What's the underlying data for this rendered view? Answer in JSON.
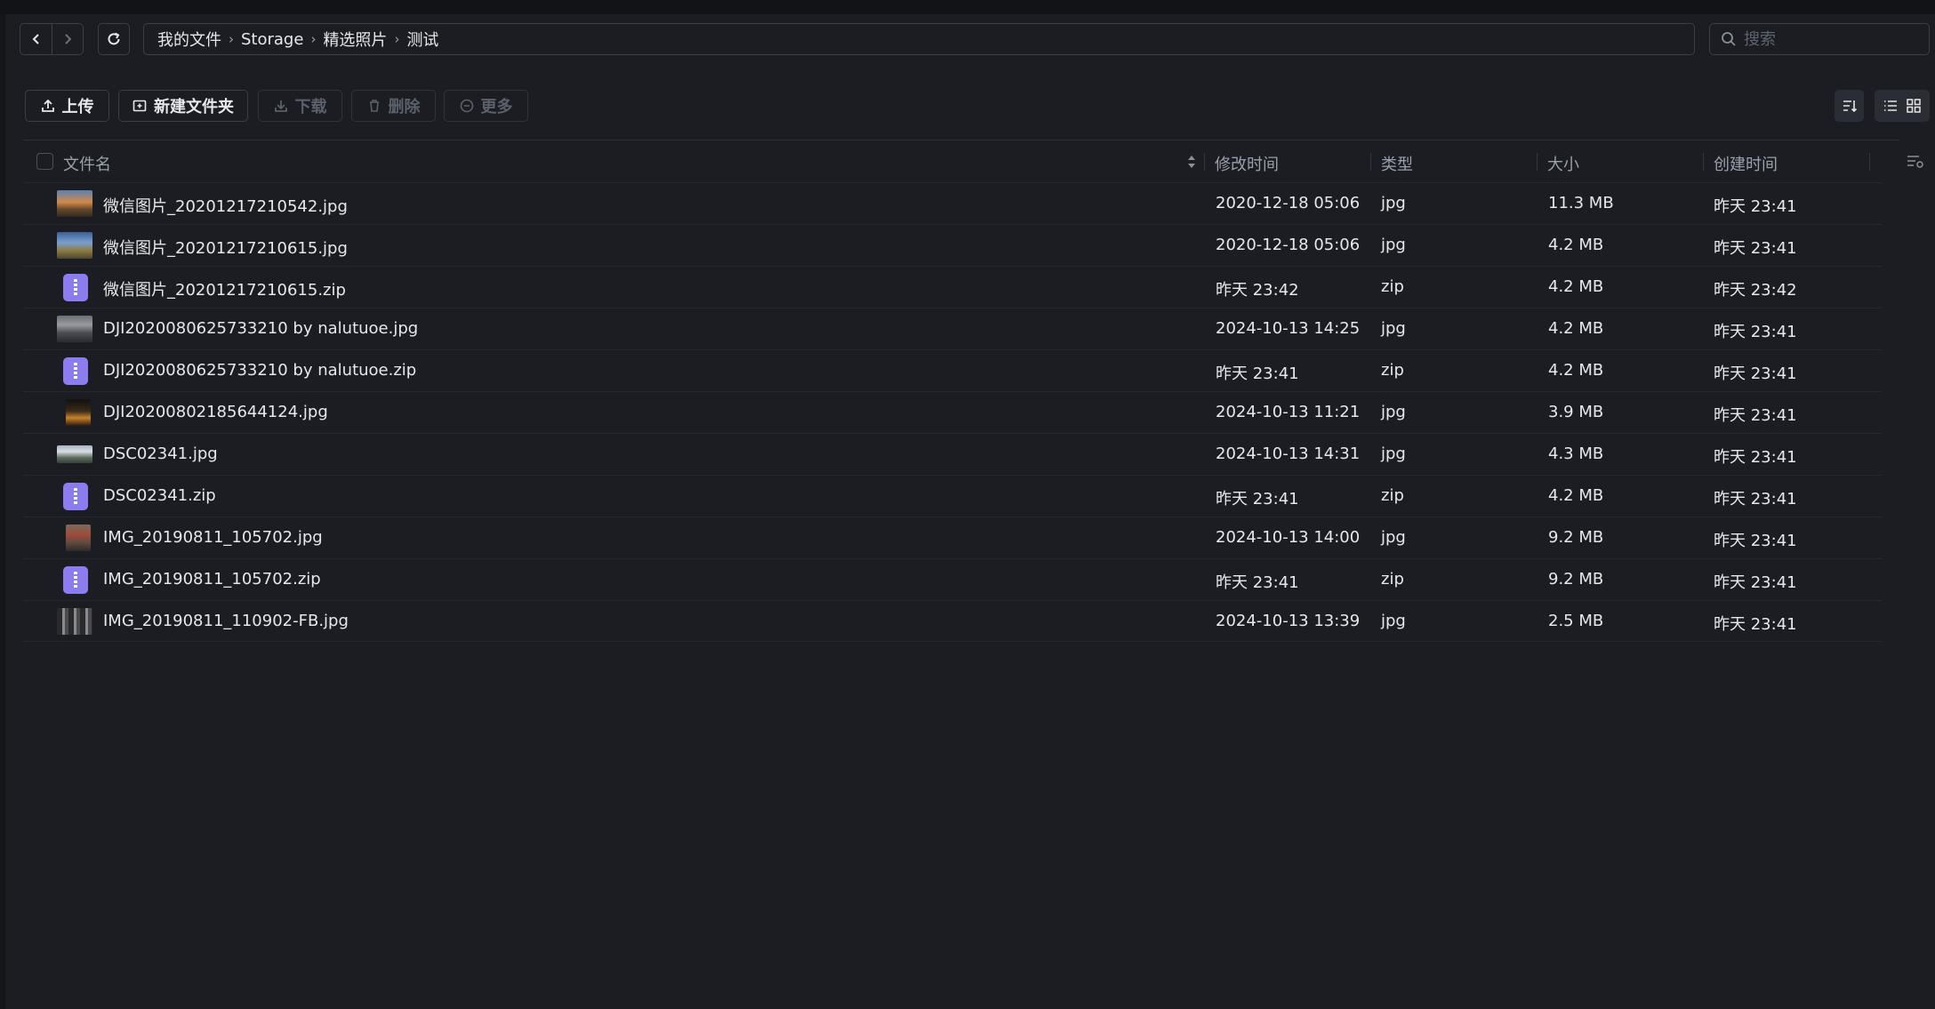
{
  "breadcrumb": [
    "我的文件",
    "Storage",
    "精选照片",
    "测试"
  ],
  "search": {
    "placeholder": "搜索"
  },
  "toolbar": {
    "upload": "上传",
    "new_folder": "新建文件夹",
    "download": "下载",
    "delete": "删除",
    "more": "更多"
  },
  "table": {
    "columns": {
      "name": "文件名",
      "modified": "修改时间",
      "type": "类型",
      "size": "大小",
      "created": "创建时间"
    },
    "rows": [
      {
        "name": "微信图片_20201217210542.jpg",
        "modified": "2020-12-18 05:06",
        "type": "jpg",
        "size": "11.3 MB",
        "created": "昨天 23:41",
        "icon": "image-thumbnail"
      },
      {
        "name": "微信图片_20201217210615.jpg",
        "modified": "2020-12-18 05:06",
        "type": "jpg",
        "size": "4.2 MB",
        "created": "昨天 23:41",
        "icon": "image-thumbnail"
      },
      {
        "name": "微信图片_20201217210615.zip",
        "modified": "昨天 23:42",
        "type": "zip",
        "size": "4.2 MB",
        "created": "昨天 23:42",
        "icon": "zip-icon"
      },
      {
        "name": "DJI2020080625733210 by nalutuoe.jpg",
        "modified": "2024-10-13 14:25",
        "type": "jpg",
        "size": "4.2 MB",
        "created": "昨天 23:41",
        "icon": "image-thumbnail"
      },
      {
        "name": "DJI2020080625733210 by nalutuoe.zip",
        "modified": "昨天 23:41",
        "type": "zip",
        "size": "4.2 MB",
        "created": "昨天 23:41",
        "icon": "zip-icon"
      },
      {
        "name": "DJI20200802185644124.jpg",
        "modified": "2024-10-13 11:21",
        "type": "jpg",
        "size": "3.9 MB",
        "created": "昨天 23:41",
        "icon": "image-thumbnail"
      },
      {
        "name": "DSC02341.jpg",
        "modified": "2024-10-13 14:31",
        "type": "jpg",
        "size": "4.3 MB",
        "created": "昨天 23:41",
        "icon": "image-thumbnail"
      },
      {
        "name": "DSC02341.zip",
        "modified": "昨天 23:41",
        "type": "zip",
        "size": "4.2 MB",
        "created": "昨天 23:41",
        "icon": "zip-icon"
      },
      {
        "name": "IMG_20190811_105702.jpg",
        "modified": "2024-10-13 14:00",
        "type": "jpg",
        "size": "9.2 MB",
        "created": "昨天 23:41",
        "icon": "image-thumbnail"
      },
      {
        "name": "IMG_20190811_105702.zip",
        "modified": "昨天 23:41",
        "type": "zip",
        "size": "9.2 MB",
        "created": "昨天 23:41",
        "icon": "zip-icon"
      },
      {
        "name": "IMG_20190811_110902-FB.jpg",
        "modified": "2024-10-13 13:39",
        "type": "jpg",
        "size": "2.5 MB",
        "created": "昨天 23:41",
        "icon": "image-thumbnail"
      }
    ]
  },
  "colors": {
    "background": "#1b1d22",
    "border": "#3a3e46",
    "text": "#e6e8eb",
    "muted": "#9aa0a9",
    "zip_accent": "#8b7df0"
  }
}
